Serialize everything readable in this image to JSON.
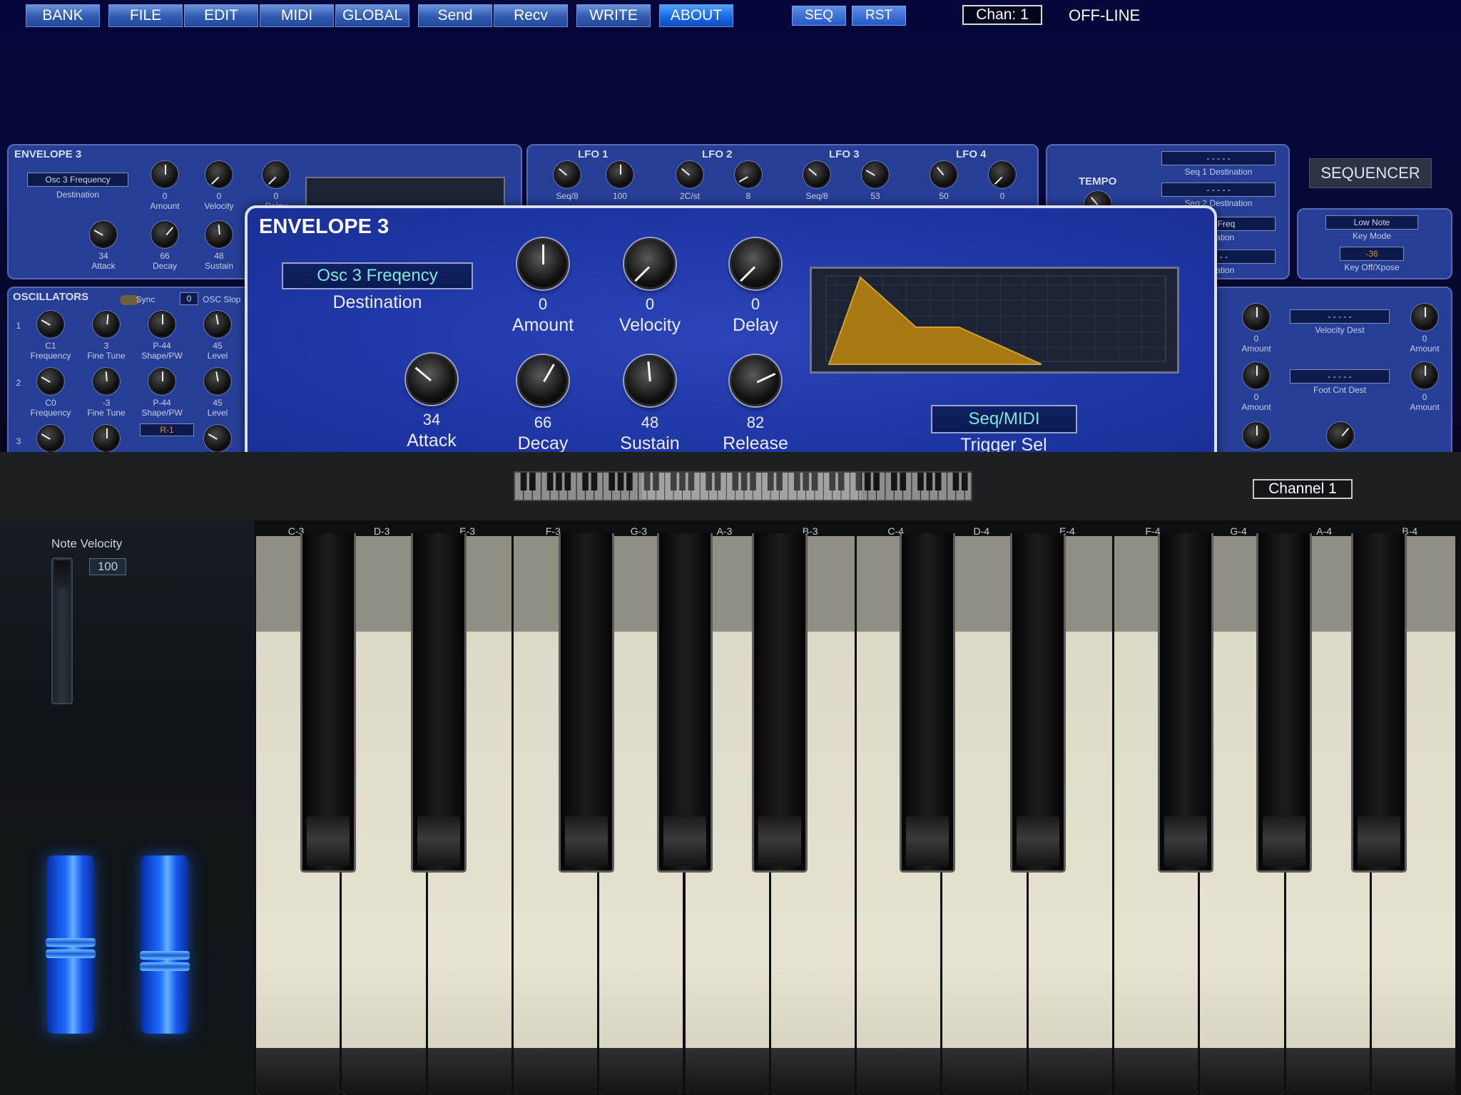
{
  "toolbar": {
    "buttons": [
      {
        "label": "BANK"
      },
      {
        "label": "FILE"
      },
      {
        "label": "EDIT"
      },
      {
        "label": "MIDI"
      },
      {
        "label": "GLOBAL"
      },
      {
        "label": "Send"
      },
      {
        "label": "Recv"
      },
      {
        "label": "WRITE"
      },
      {
        "label": "ABOUT"
      }
    ],
    "seq_label": "SEQ",
    "rst_label": "RST",
    "channel": "Chan: 1",
    "status": "OFF-LINE"
  },
  "bg": {
    "envelope3": {
      "title": "ENVELOPE 3",
      "destination": "Osc 3 Frequency",
      "destination_label": "Destination",
      "knobs_top": [
        {
          "value": "0",
          "label": "Amount"
        },
        {
          "value": "0",
          "label": "Velocity"
        },
        {
          "value": "0",
          "label": "Delay"
        }
      ],
      "knobs_bottom": [
        {
          "value": "34",
          "label": "Attack"
        },
        {
          "value": "66",
          "label": "Decay"
        },
        {
          "value": "48",
          "label": "Sustain"
        }
      ]
    },
    "lfo": {
      "titles": [
        "LFO 1",
        "LFO 2",
        "LFO 3",
        "LFO 4"
      ],
      "knob_values": [
        "Seq/8",
        "100",
        "2C/st",
        "8",
        "Seq/8",
        "53",
        "50",
        "0"
      ]
    },
    "tempo": {
      "title": "TEMPO",
      "displays": [
        "- - - - -",
        "- - - - -",
        "ack Freq",
        "- - - -"
      ],
      "labels": [
        "Seq 1 Destination",
        "Seq 2 Destination",
        "stination",
        "stination"
      ]
    },
    "sequencer_button": "SEQUENCER",
    "keymode": {
      "display1": "Low Note",
      "label1": "Key Mode",
      "display2": "-36",
      "label2": "Key Off/Xpose"
    },
    "oscillators": {
      "title": "OSCILLATORS",
      "sync_label": "Sync",
      "sync_value": "0",
      "slop_label": "OSC Slop",
      "row_numbers": [
        "1",
        "2",
        "3"
      ],
      "row1": [
        {
          "value": "C1",
          "label": "Frequency"
        },
        {
          "value": "3",
          "label": "Fine Tune"
        },
        {
          "value": "P-44",
          "label": "Shape/PW"
        },
        {
          "value": "45",
          "label": "Level"
        }
      ],
      "row2": [
        {
          "value": "C0",
          "label": "Frequency"
        },
        {
          "value": "-3",
          "label": "Fine Tune"
        },
        {
          "value": "P-44",
          "label": "Shape/PW"
        },
        {
          "value": "45",
          "label": "Level"
        }
      ],
      "row3_display": "R-1"
    },
    "mod": {
      "rows": [
        {
          "amount_value": "0",
          "amount_label": "Amount",
          "dest_display": "- - - - -",
          "dest_label": "Velocity Dest",
          "right_value": "0",
          "right_label": "Amount"
        },
        {
          "amount_value": "0",
          "amount_label": "Amount",
          "dest_display": "- - - - -",
          "dest_label": "Foot Cnt Dest",
          "right_value": "0",
          "right_label": "Amount"
        }
      ]
    }
  },
  "popup": {
    "title": "ENVELOPE 3",
    "destination": "Osc 3 Freqency",
    "destination_label": "Destination",
    "knobs_top": [
      {
        "value": "0",
        "label": "Amount"
      },
      {
        "value": "0",
        "label": "Velocity"
      },
      {
        "value": "0",
        "label": "Delay"
      }
    ],
    "knobs_bottom": [
      {
        "value": "34",
        "label": "Attack"
      },
      {
        "value": "66",
        "label": "Decay"
      },
      {
        "value": "48",
        "label": "Sustain"
      },
      {
        "value": "82",
        "label": "Release"
      }
    ],
    "trigger_value": "Seq/MIDI",
    "trigger_label": "Trigger Sel",
    "envelope_color": "#b07d12"
  },
  "keyboard": {
    "channel": "Channel  1",
    "note_velocity_label": "Note Velocity",
    "note_velocity_value": "100",
    "note_labels": [
      "C-3",
      "D-3",
      "E-3",
      "F-3",
      "G-3",
      "A-3",
      "B-3",
      "C-4",
      "D-4",
      "E-4",
      "F-4",
      "G-4",
      "A-4",
      "B-4"
    ]
  }
}
